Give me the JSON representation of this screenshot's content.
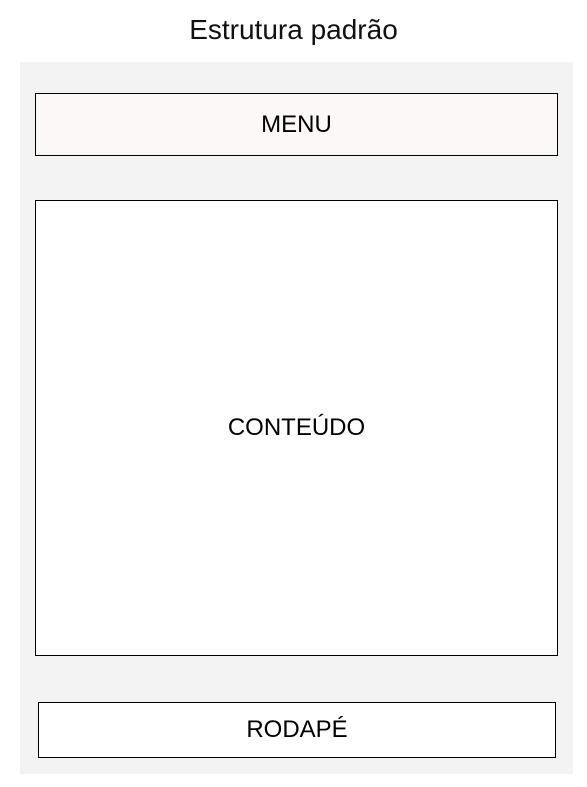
{
  "title": "Estrutura padrão",
  "colors": {
    "frame_background": "#f3f3f3",
    "menu_background": "#fdf8f8",
    "content_background": "#ffffff",
    "footer_background": "#ffffff",
    "border": "#000000"
  },
  "sections": {
    "menu": {
      "label": "MENU"
    },
    "content": {
      "label": "CONTEÚDO"
    },
    "footer": {
      "label": "RODAPÉ"
    }
  }
}
